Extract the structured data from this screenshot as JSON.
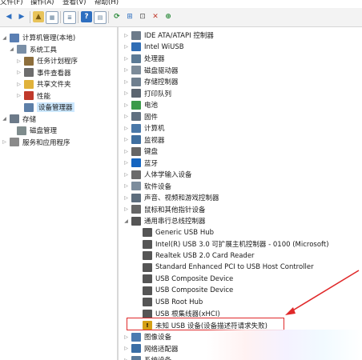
{
  "menu": [
    "文件(F)",
    "操作(A)",
    "查看(V)",
    "帮助(H)"
  ],
  "left_tree": [
    {
      "label": "计算机管理(本地)",
      "level": 0,
      "expander": "◢",
      "icon": "computer-management-icon",
      "color": "#5a7fb3"
    },
    {
      "label": "系统工具",
      "level": 1,
      "expander": "◢",
      "icon": "system-tools-icon",
      "color": "#7a8fa6"
    },
    {
      "label": "任务计划程序",
      "level": 2,
      "expander": "▷",
      "icon": "task-scheduler-icon",
      "color": "#8d6e3c"
    },
    {
      "label": "事件查看器",
      "level": 2,
      "expander": "▷",
      "icon": "event-viewer-icon",
      "color": "#6d6d6d"
    },
    {
      "label": "共享文件夹",
      "level": 2,
      "expander": "▷",
      "icon": "shared-folder-icon",
      "color": "#e0b23b"
    },
    {
      "label": "性能",
      "level": 2,
      "expander": "▷",
      "icon": "performance-icon",
      "color": "#c0392b"
    },
    {
      "label": "设备管理器",
      "level": 2,
      "expander": "",
      "icon": "device-manager-icon",
      "color": "#5d7fa8",
      "selected": true
    },
    {
      "label": "存储",
      "level": 0,
      "expander": "◢",
      "icon": "storage-icon",
      "color": "#6c7a89"
    },
    {
      "label": "磁盘管理",
      "level": 1,
      "expander": "",
      "icon": "disk-management-icon",
      "color": "#7f8c8d"
    },
    {
      "label": "服务和应用程序",
      "level": 0,
      "expander": "▷",
      "icon": "services-apps-icon",
      "color": "#8a8a8a"
    }
  ],
  "device_tree": [
    {
      "label": "IDE ATA/ATAPI 控制器",
      "level": 0,
      "expander": "▷",
      "icon": "ide-controller-icon",
      "color": "#6d7b8a"
    },
    {
      "label": "Intel WiUSB",
      "level": 0,
      "expander": "▷",
      "icon": "wiusb-icon",
      "color": "#2f6db5"
    },
    {
      "label": "处理器",
      "level": 0,
      "expander": "▷",
      "icon": "processor-icon",
      "color": "#5b7a95"
    },
    {
      "label": "磁盘驱动器",
      "level": 0,
      "expander": "▷",
      "icon": "disk-drive-icon",
      "color": "#7c8b99"
    },
    {
      "label": "存储控制器",
      "level": 0,
      "expander": "▷",
      "icon": "storage-controller-icon",
      "color": "#6f7f8f"
    },
    {
      "label": "打印队列",
      "level": 0,
      "expander": "▷",
      "icon": "print-queue-icon",
      "color": "#5b6570"
    },
    {
      "label": "电池",
      "level": 0,
      "expander": "▷",
      "icon": "battery-icon",
      "color": "#3b9a4a"
    },
    {
      "label": "固件",
      "level": 0,
      "expander": "▷",
      "icon": "firmware-icon",
      "color": "#607080"
    },
    {
      "label": "计算机",
      "level": 0,
      "expander": "▷",
      "icon": "computer-icon",
      "color": "#4a78a8"
    },
    {
      "label": "监视器",
      "level": 0,
      "expander": "▷",
      "icon": "monitor-icon",
      "color": "#3f6f9f"
    },
    {
      "label": "键盘",
      "level": 0,
      "expander": "▷",
      "icon": "keyboard-icon",
      "color": "#666666"
    },
    {
      "label": "蓝牙",
      "level": 0,
      "expander": "▷",
      "icon": "bluetooth-icon",
      "color": "#1565c0"
    },
    {
      "label": "人体学输入设备",
      "level": 0,
      "expander": "▷",
      "icon": "hid-icon",
      "color": "#6a6a6a"
    },
    {
      "label": "软件设备",
      "level": 0,
      "expander": "▷",
      "icon": "software-device-icon",
      "color": "#7d8d9d"
    },
    {
      "label": "声音、视频和游戏控制器",
      "level": 0,
      "expander": "▷",
      "icon": "sound-icon",
      "color": "#5d6d7d"
    },
    {
      "label": "鼠标和其他指针设备",
      "level": 0,
      "expander": "▷",
      "icon": "mouse-icon",
      "color": "#666666"
    },
    {
      "label": "通用串行总线控制器",
      "level": 0,
      "expander": "◢",
      "icon": "usb-controller-icon",
      "color": "#555555"
    },
    {
      "label": "Generic USB Hub",
      "level": 1,
      "expander": "",
      "icon": "usb-icon",
      "color": "#555555"
    },
    {
      "label": "Intel(R) USB 3.0 可扩展主机控制器 - 0100 (Microsoft)",
      "level": 1,
      "expander": "",
      "icon": "usb-icon",
      "color": "#555555"
    },
    {
      "label": "Realtek USB 2.0 Card Reader",
      "level": 1,
      "expander": "",
      "icon": "usb-icon",
      "color": "#555555"
    },
    {
      "label": "Standard Enhanced PCI to USB Host Controller",
      "level": 1,
      "expander": "",
      "icon": "usb-icon",
      "color": "#555555"
    },
    {
      "label": "USB Composite Device",
      "level": 1,
      "expander": "",
      "icon": "usb-icon",
      "color": "#555555"
    },
    {
      "label": "USB Composite Device",
      "level": 1,
      "expander": "",
      "icon": "usb-icon",
      "color": "#555555"
    },
    {
      "label": "USB Root Hub",
      "level": 1,
      "expander": "",
      "icon": "usb-icon",
      "color": "#555555"
    },
    {
      "label": "USB 根集线器(xHCI)",
      "level": 1,
      "expander": "",
      "icon": "usb-icon",
      "color": "#555555"
    },
    {
      "label": "未知 USB 设备(设备描述符请求失败)",
      "level": 1,
      "expander": "",
      "icon": "unknown-usb-warning-icon",
      "color": "#d4a017",
      "flagged": true
    },
    {
      "label": "图像设备",
      "level": 0,
      "expander": "▷",
      "icon": "imaging-device-icon",
      "color": "#4b7bb0"
    },
    {
      "label": "网络适配器",
      "level": 0,
      "expander": "▷",
      "icon": "network-adapter-icon",
      "color": "#3a6ea5"
    },
    {
      "label": "系统设备",
      "level": 0,
      "expander": "▷",
      "icon": "system-device-icon",
      "color": "#5a7a9a"
    }
  ],
  "highlight_color": "#e0292a"
}
